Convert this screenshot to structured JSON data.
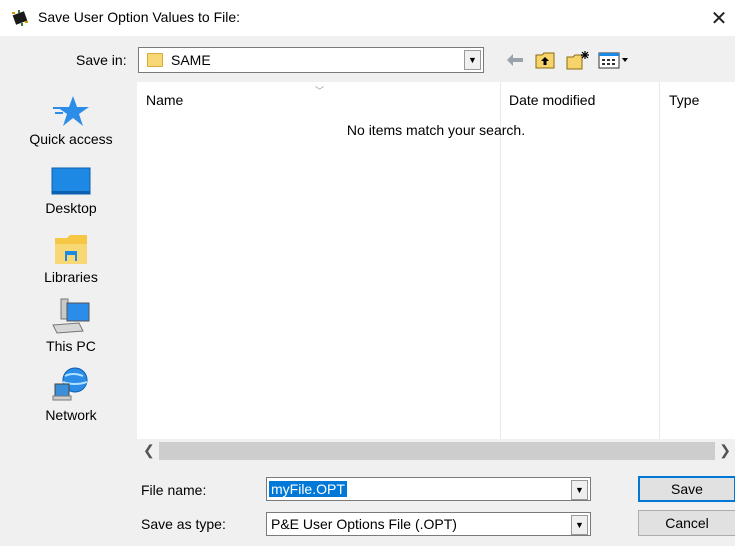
{
  "window": {
    "title": "Save User Option Values to File:",
    "close_glyph": "✕"
  },
  "toolbar": {
    "save_in_label": "Save in:",
    "save_in_value": "SAME",
    "icons": [
      "back-arrow-icon",
      "up-folder-icon",
      "new-folder-icon",
      "view-menu-icon"
    ]
  },
  "places": [
    {
      "label": "Quick access",
      "icon": "star-icon"
    },
    {
      "label": "Desktop",
      "icon": "desktop-icon"
    },
    {
      "label": "Libraries",
      "icon": "libraries-icon"
    },
    {
      "label": "This PC",
      "icon": "computer-icon"
    },
    {
      "label": "Network",
      "icon": "network-icon"
    }
  ],
  "filelist": {
    "columns": [
      "Name",
      "Date modified",
      "Type"
    ],
    "empty_message": "No items match your search."
  },
  "form": {
    "file_name_label": "File name:",
    "file_name_value": "myFile.OPT",
    "save_type_label": "Save as type:",
    "save_type_value": "P&E User Options File (.OPT)"
  },
  "buttons": {
    "save": "Save",
    "cancel": "Cancel"
  },
  "colors": {
    "selection": "#0078d7",
    "folder": "#f8d775",
    "accent_blue": "#1e88e5"
  }
}
